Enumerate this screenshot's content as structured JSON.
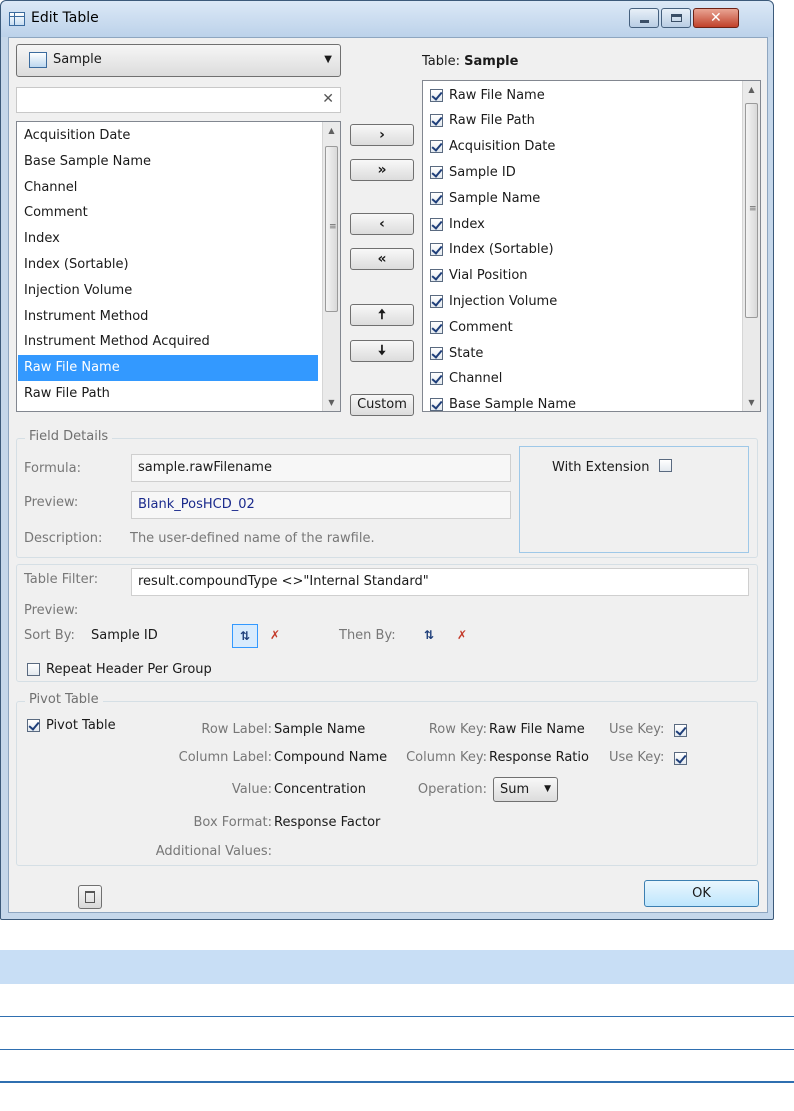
{
  "window": {
    "title": "Edit Table"
  },
  "source": {
    "combo_value": "Sample",
    "search_value": "",
    "available_fields": [
      "Acquisition Date",
      "Base Sample Name",
      "Channel",
      "Comment",
      "Index",
      "Index (Sortable)",
      "Injection Volume",
      "Instrument Method",
      "Instrument Method Acquired",
      "Raw File Name",
      "Raw File Path"
    ],
    "selected_field": "Raw File Name"
  },
  "buttons": {
    "move_right": "›",
    "move_all_right": "»",
    "move_left": "‹",
    "move_all_left": "«",
    "move_up": "🠅",
    "move_down": "🠇",
    "custom": "Custom",
    "ok": "OK"
  },
  "table": {
    "label_prefix": "Table:",
    "name": "Sample",
    "columns": [
      {
        "label": "Raw File Name",
        "checked": true
      },
      {
        "label": "Raw File Path",
        "checked": true
      },
      {
        "label": "Acquisition Date",
        "checked": true
      },
      {
        "label": "Sample ID",
        "checked": true
      },
      {
        "label": "Sample Name",
        "checked": true
      },
      {
        "label": "Index",
        "checked": true
      },
      {
        "label": "Index (Sortable)",
        "checked": true
      },
      {
        "label": "Vial Position",
        "checked": true
      },
      {
        "label": "Injection Volume",
        "checked": true
      },
      {
        "label": "Comment",
        "checked": true
      },
      {
        "label": "State",
        "checked": true
      },
      {
        "label": "Channel",
        "checked": true
      },
      {
        "label": "Base Sample Name",
        "checked": true
      }
    ]
  },
  "field_details": {
    "title": "Field Details",
    "formula_label": "Formula:",
    "formula_value": "sample.rawFilename",
    "preview_label": "Preview:",
    "preview_value": "Blank_PosHCD_02",
    "description_label": "Description:",
    "description_value": "The user-defined name of the rawfile.",
    "with_extension_label": "With Extension",
    "with_extension_checked": false
  },
  "filter": {
    "table_filter_label": "Table Filter:",
    "table_filter_value": "result.compoundType <>\"Internal Standard\"",
    "preview_label": "Preview:",
    "sort_by_label": "Sort By:",
    "sort_by_value": "Sample ID",
    "then_by_label": "Then By:",
    "repeat_header_label": "Repeat Header Per Group",
    "repeat_header_checked": false
  },
  "pivot": {
    "title": "Pivot Table",
    "pivot_checkbox_label": "Pivot Table",
    "pivot_checked": true,
    "row_label_label": "Row Label:",
    "row_label_value": "Sample Name",
    "row_key_label": "Row Key:",
    "row_key_value": "Raw File Name",
    "use_key_label": "Use Key:",
    "row_use_key": true,
    "column_label_label": "Column Label:",
    "column_label_value": "Compound Name",
    "column_key_label": "Column Key:",
    "column_key_value": "Response Ratio",
    "column_use_key": true,
    "value_label": "Value:",
    "value_value": "Concentration",
    "operation_label": "Operation:",
    "operation_value": "Sum",
    "box_format_label": "Box Format:",
    "box_format_value": "Response Factor",
    "additional_values_label": "Additional Values:"
  }
}
